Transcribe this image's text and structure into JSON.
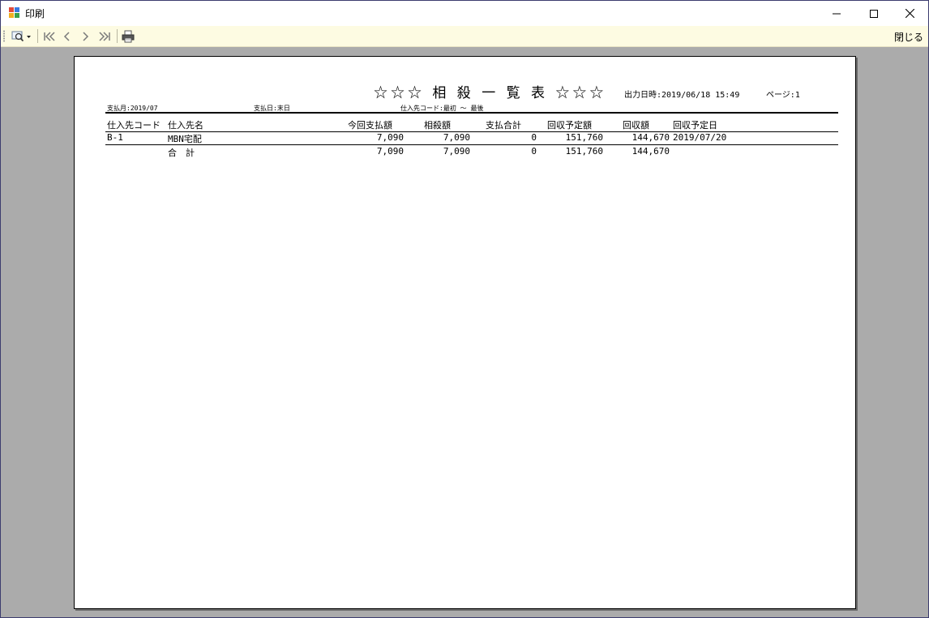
{
  "window": {
    "title": "印刷"
  },
  "toolbar": {
    "close_label": "閉じる"
  },
  "report": {
    "title": "☆☆☆ 相 殺 一 覧 表 ☆☆☆",
    "output_datetime": "出力日時:2019/06/18 15:49",
    "page": "ページ:1",
    "pay_month": "支払月:2019/07",
    "pay_day": "支払日:末日",
    "supplier_range": "仕入先コード:最初 ～ 最後",
    "columns": {
      "code": "仕入先コード",
      "name": "仕入先名",
      "this_payment": "今回支払額",
      "offset": "相殺額",
      "payment_total": "支払合計",
      "scheduled_collection": "回収予定額",
      "collected": "回収額",
      "scheduled_date": "回収予定日"
    },
    "rows": [
      {
        "code": "B-1",
        "name": "MBN宅配",
        "this_payment": "7,090",
        "offset": "7,090",
        "payment_total": "0",
        "scheduled_collection": "151,760",
        "collected": "144,670",
        "scheduled_date": "2019/07/20"
      }
    ],
    "total": {
      "label": "合　計",
      "this_payment": "7,090",
      "offset": "7,090",
      "payment_total": "0",
      "scheduled_collection": "151,760",
      "collected": "144,670"
    }
  }
}
